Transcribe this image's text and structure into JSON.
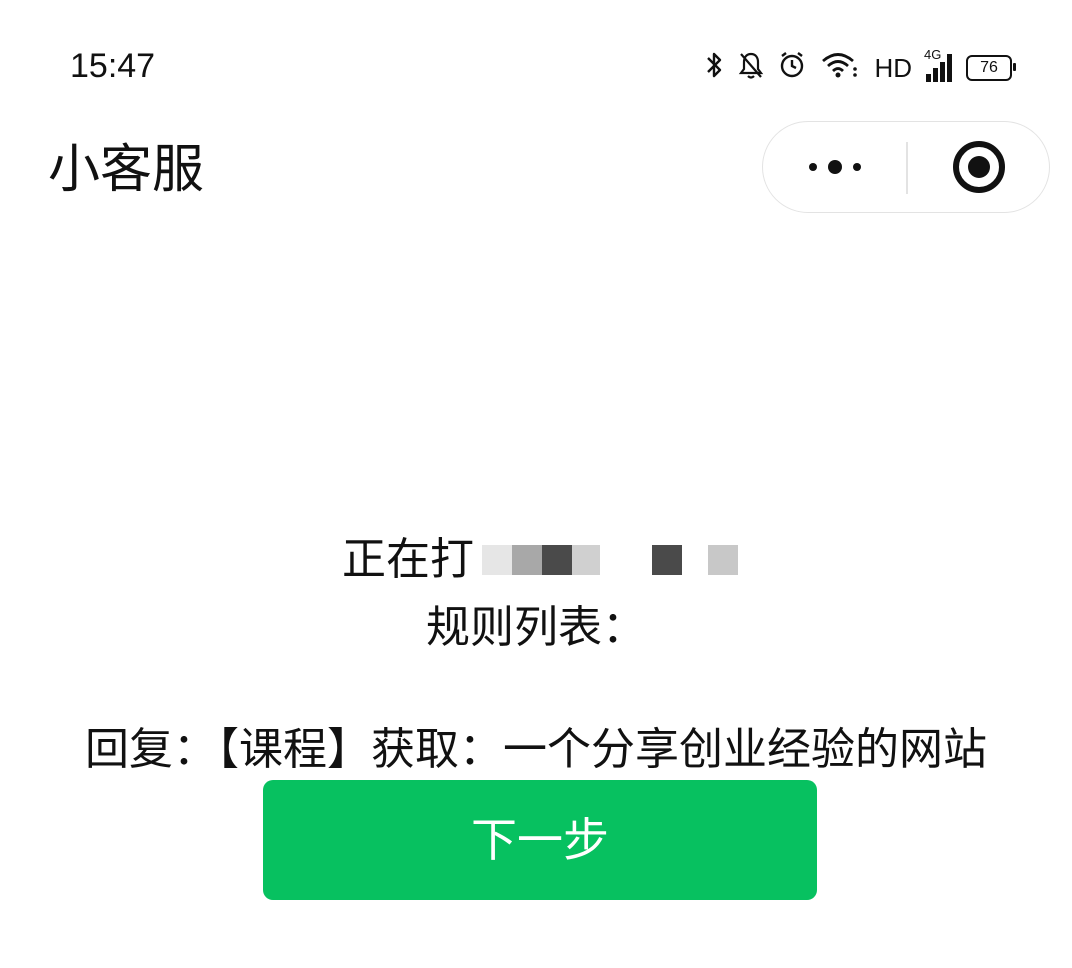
{
  "status_bar": {
    "time": "15:47",
    "network_label": "HD",
    "signal_label": "4G",
    "battery_level": "76",
    "icons": [
      "bluetooth-icon",
      "mute-icon",
      "alarm-icon",
      "wifi-icon",
      "signal-icon",
      "battery-icon"
    ]
  },
  "nav": {
    "title": "小客服",
    "more_icon": "more-dots-icon",
    "close_icon": "target-close-icon"
  },
  "content": {
    "line1": "正在打",
    "line2": "规则列表：",
    "line3": "回复：【课程】获取：一个分享创业经验的网站"
  },
  "actions": {
    "next_label": "下一步"
  },
  "colors": {
    "primary_green": "#07c160",
    "text": "#111111",
    "capsule_border": "#e3e3e3"
  }
}
